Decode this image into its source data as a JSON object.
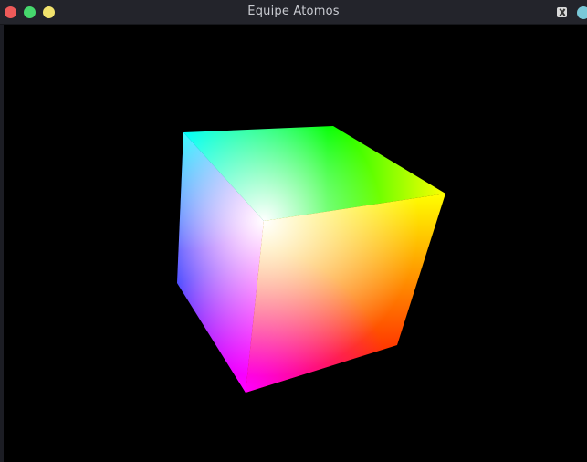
{
  "window": {
    "title": "Equipe Atomos"
  },
  "titlebar": {
    "buttons": [
      "close",
      "minimize",
      "maximize"
    ],
    "icons": [
      "app-icon",
      "extra-button"
    ]
  },
  "viewport": {
    "background": "#000000",
    "object": "rgb-color-cube",
    "vertex_colors": {
      "white": "#ffffff",
      "cyan": "#00ffff",
      "green": "#00ff00",
      "yellow": "#ffff00",
      "red": "#ff0000",
      "magenta": "#ff00ff",
      "blue": "#0000ff"
    }
  },
  "colors": {
    "titlebar": "#23242b",
    "close": "#ee5a59",
    "minimize": "#46d86d",
    "maximize": "#f1e26d"
  }
}
